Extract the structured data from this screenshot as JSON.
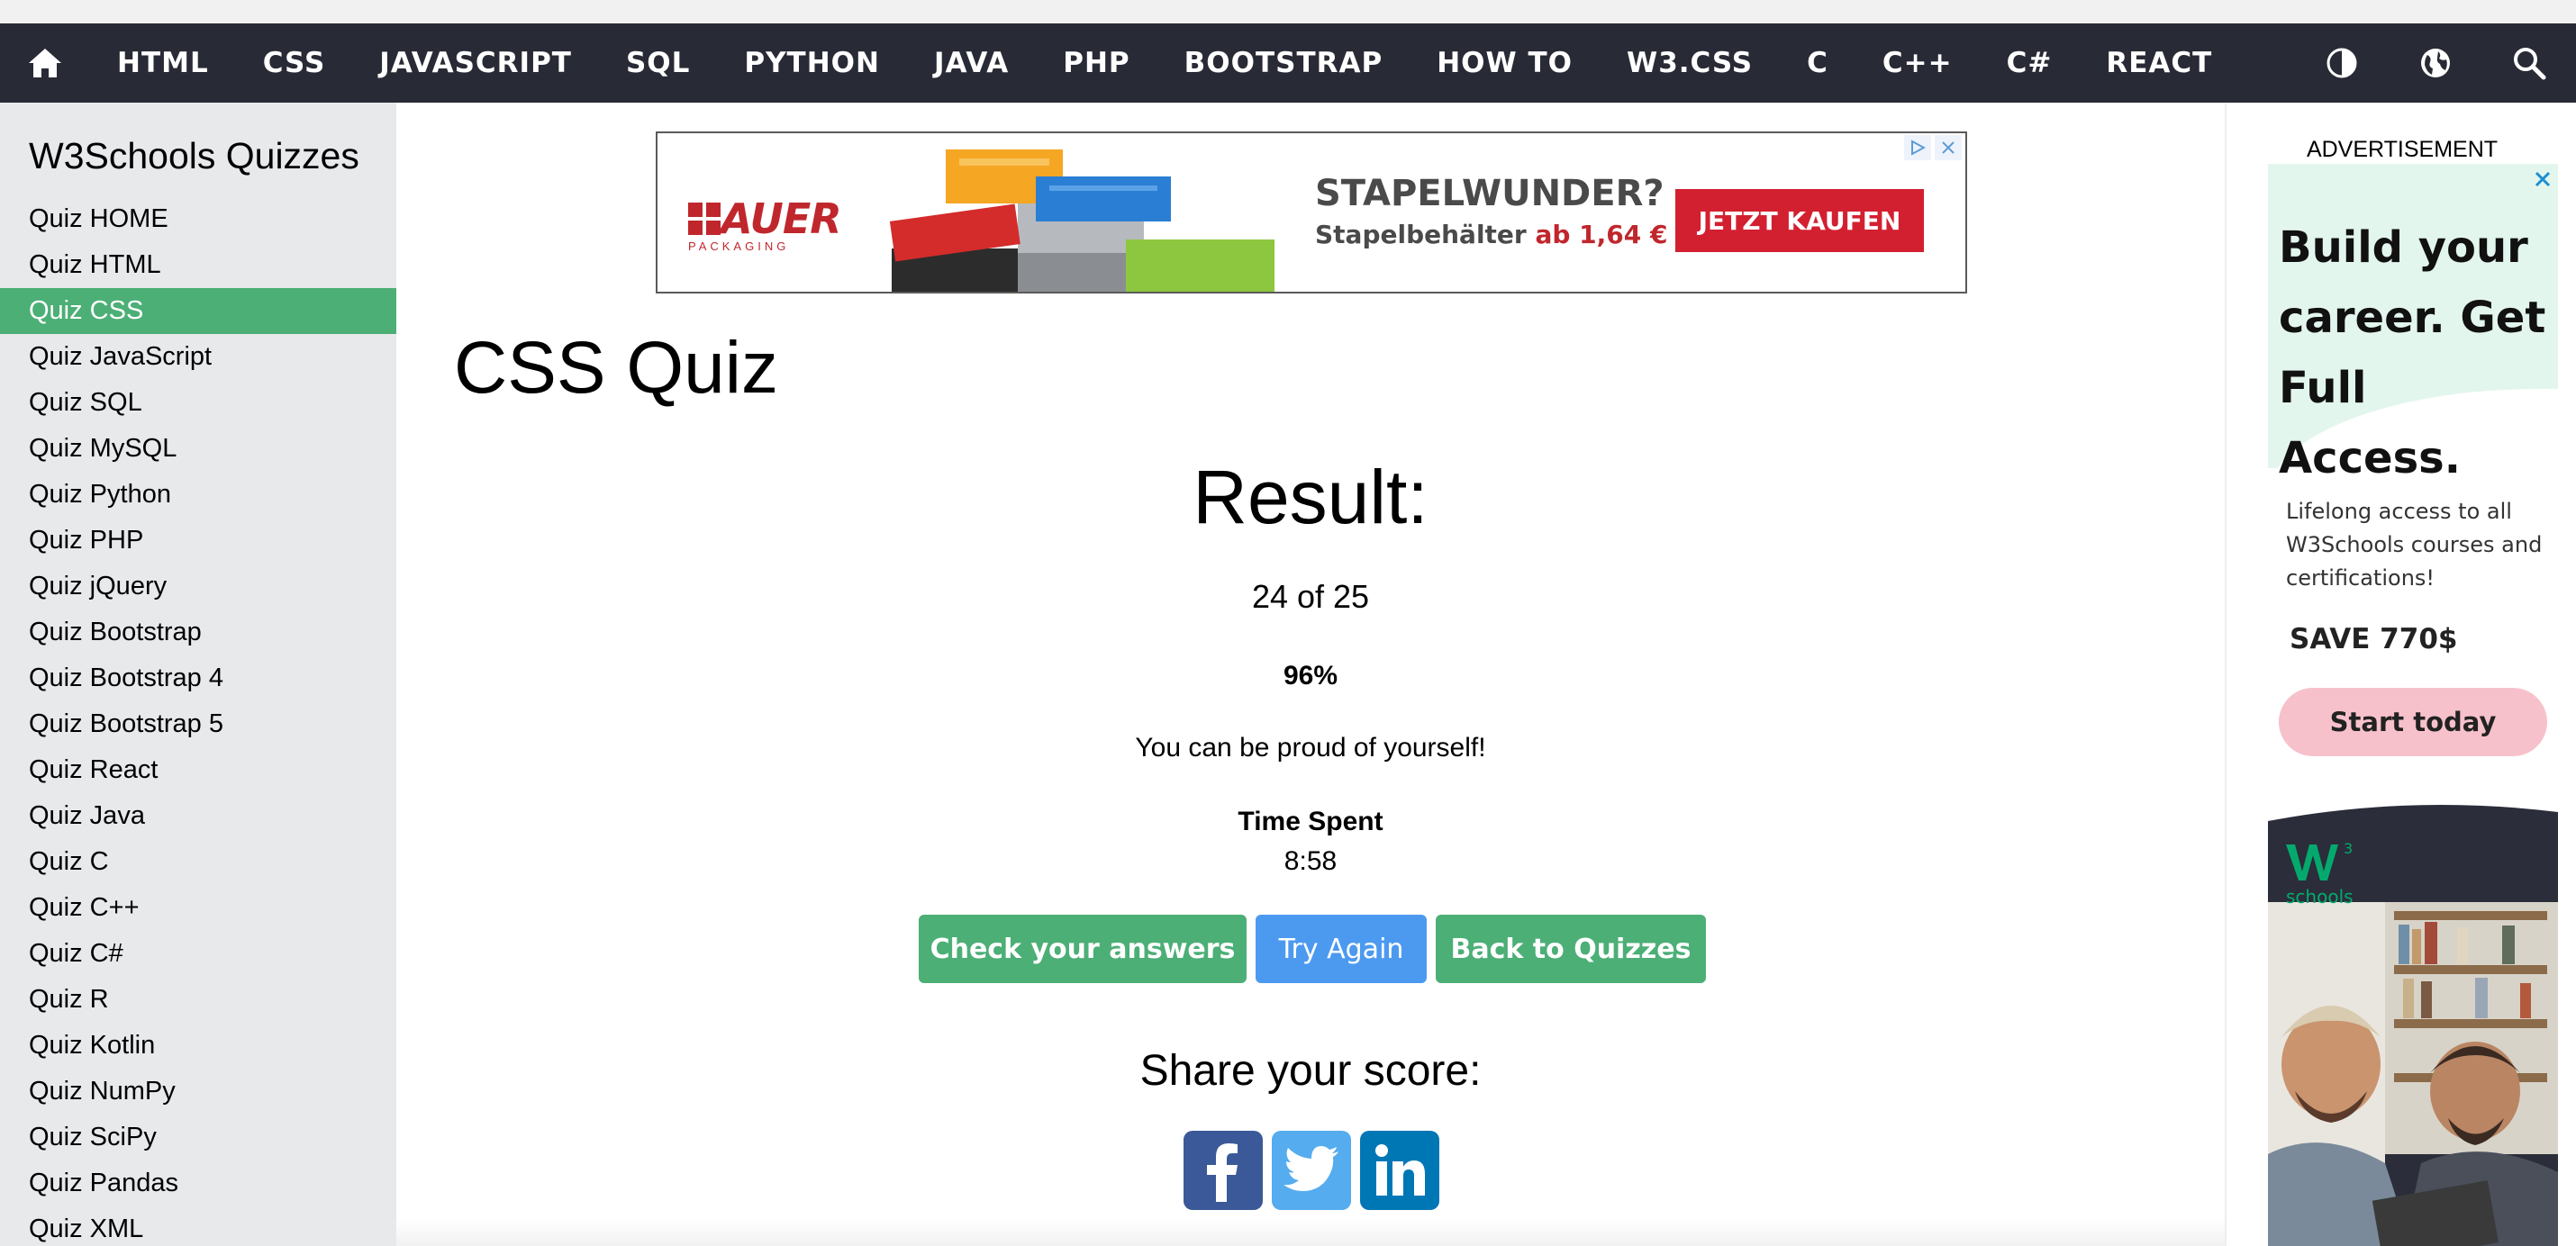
{
  "nav": {
    "items": [
      "HTML",
      "CSS",
      "JAVASCRIPT",
      "SQL",
      "PYTHON",
      "JAVA",
      "PHP",
      "BOOTSTRAP",
      "HOW TO",
      "W3.CSS",
      "C",
      "C++",
      "C#",
      "REACT"
    ],
    "icons": [
      "home-icon",
      "contrast-icon",
      "globe-icon",
      "search-icon"
    ],
    "background": "#282a35"
  },
  "sidebar": {
    "title": "W3Schools Quizzes",
    "items": [
      {
        "label": "Quiz HOME"
      },
      {
        "label": "Quiz HTML"
      },
      {
        "label": "Quiz CSS",
        "active": true
      },
      {
        "label": "Quiz JavaScript"
      },
      {
        "label": "Quiz SQL"
      },
      {
        "label": "Quiz MySQL"
      },
      {
        "label": "Quiz Python"
      },
      {
        "label": "Quiz PHP"
      },
      {
        "label": "Quiz jQuery"
      },
      {
        "label": "Quiz Bootstrap"
      },
      {
        "label": "Quiz Bootstrap 4"
      },
      {
        "label": "Quiz Bootstrap 5"
      },
      {
        "label": "Quiz React"
      },
      {
        "label": "Quiz Java"
      },
      {
        "label": "Quiz C"
      },
      {
        "label": "Quiz C++"
      },
      {
        "label": "Quiz C#"
      },
      {
        "label": "Quiz R"
      },
      {
        "label": "Quiz Kotlin"
      },
      {
        "label": "Quiz NumPy"
      },
      {
        "label": "Quiz SciPy"
      },
      {
        "label": "Quiz Pandas"
      },
      {
        "label": "Quiz XML"
      }
    ],
    "active_color": "#4caf76"
  },
  "banner_ad": {
    "logo": "AUER",
    "logo_sub": "PACKAGING",
    "headline": "STAPELWUNDER?",
    "sub_prefix": "Stapelbehälter",
    "sub_price": "ab 1,64 €",
    "cta": "JETZT KAUFEN"
  },
  "main": {
    "title": "CSS Quiz",
    "result_heading": "Result:",
    "score": "24 of 25",
    "percent": "96%",
    "message": "You can be proud of yourself!",
    "time_label": "Time Spent",
    "time_value": "8:58",
    "buttons": {
      "check": "Check your answers",
      "try_again": "Try Again",
      "back": "Back to Quizzes"
    },
    "share_heading": "Share your score:",
    "share_icons": [
      "facebook-icon",
      "twitter-icon",
      "linkedin-icon"
    ]
  },
  "side_ad": {
    "label": "ADVERTISEMENT",
    "headline": "Build your career. Get Full Access.",
    "body": "Lifelong access to all W3Schools courses and certifications!",
    "save": "SAVE 770$",
    "cta": "Start today",
    "brand_sub": "schools"
  },
  "colors": {
    "green": "#4caf76",
    "blue": "#4c9af0",
    "facebook": "#3b5998",
    "twitter": "#55acee",
    "linkedin": "#0077b5"
  }
}
